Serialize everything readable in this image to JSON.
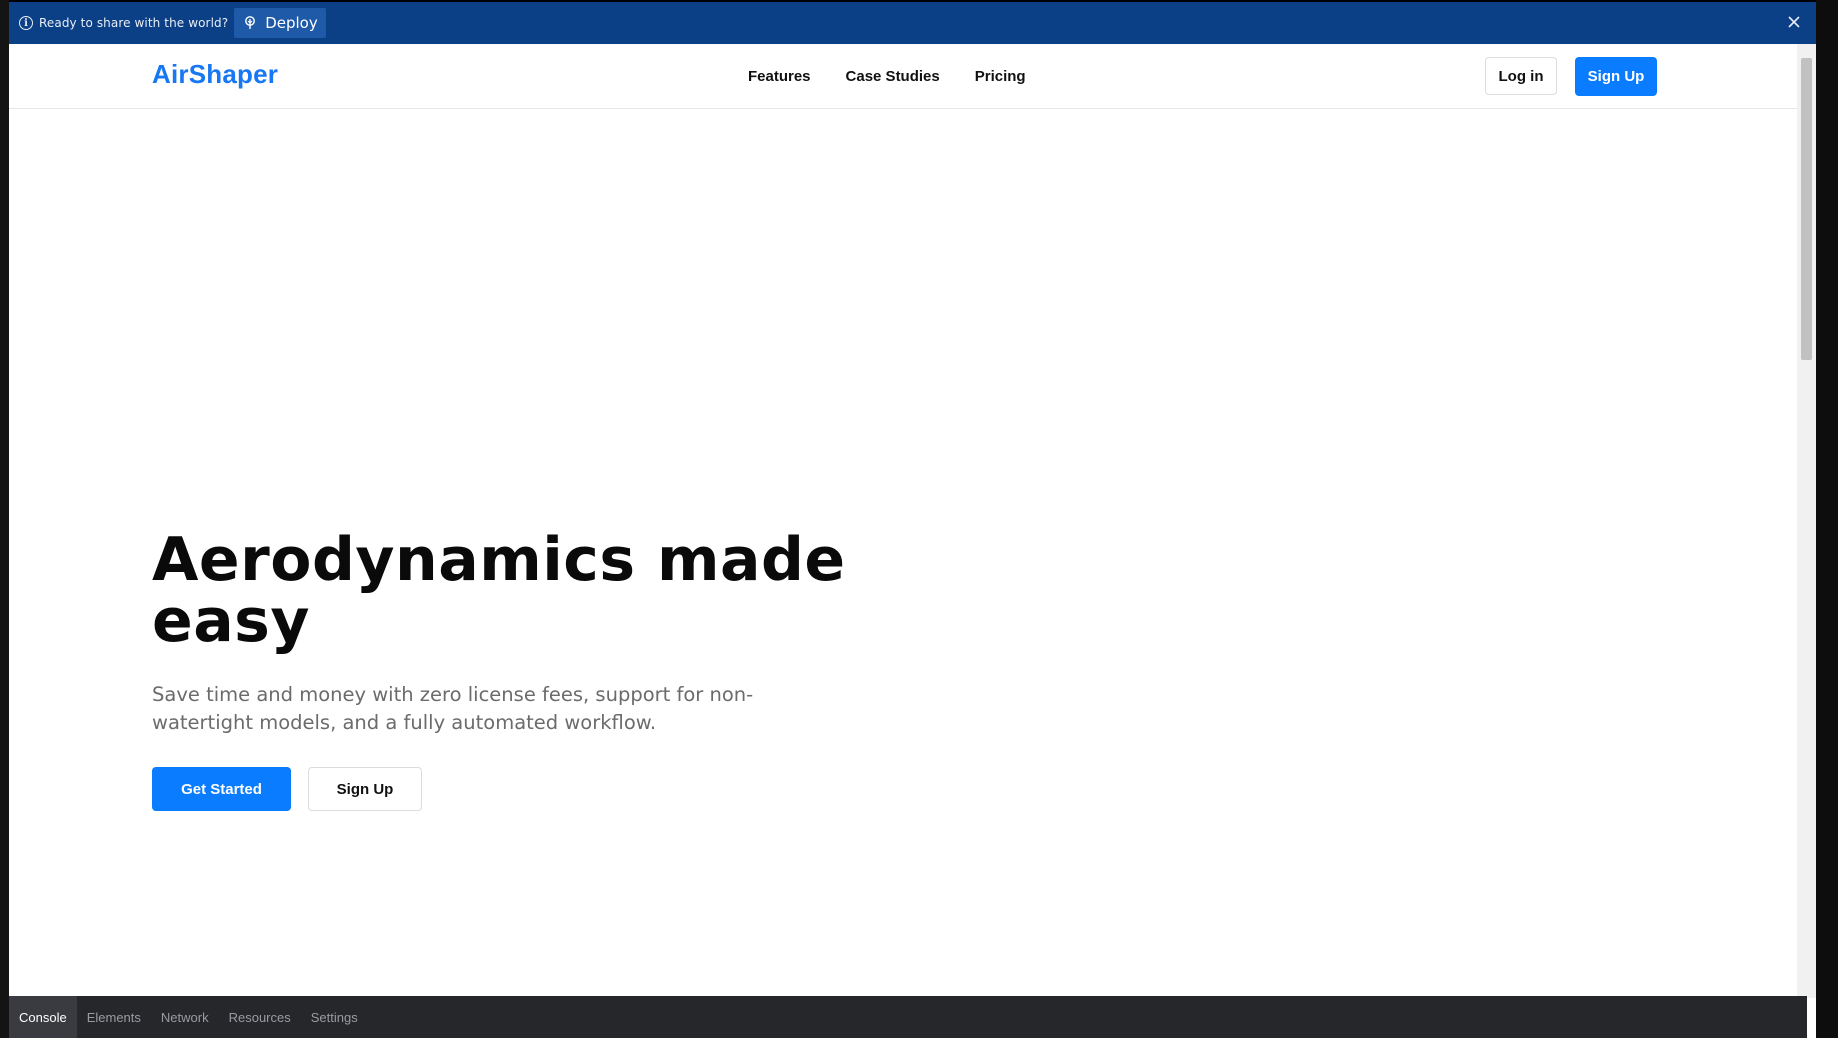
{
  "deploy_bar": {
    "message": "Ready to share with the world?",
    "deploy_label": "Deploy",
    "background": "#0b3f86"
  },
  "nav": {
    "logo": "AirShaper",
    "links": [
      "Features",
      "Case Studies",
      "Pricing"
    ],
    "login_label": "Log in",
    "signup_label": "Sign Up"
  },
  "hero": {
    "title": "Aerodynamics made easy",
    "subtitle": "Save time and money with zero license fees, support for non-watertight models, and a fully automated workflow.",
    "primary_cta": "Get Started",
    "secondary_cta": "Sign Up"
  },
  "devtools": {
    "tabs": [
      "Console",
      "Elements",
      "Network",
      "Resources",
      "Settings"
    ],
    "active_tab": "Console"
  },
  "colors": {
    "brand": "#0a7cff",
    "logo": "#1877f2",
    "deploy_bar": "#0b3f86",
    "devtools_bg": "#26272b"
  }
}
